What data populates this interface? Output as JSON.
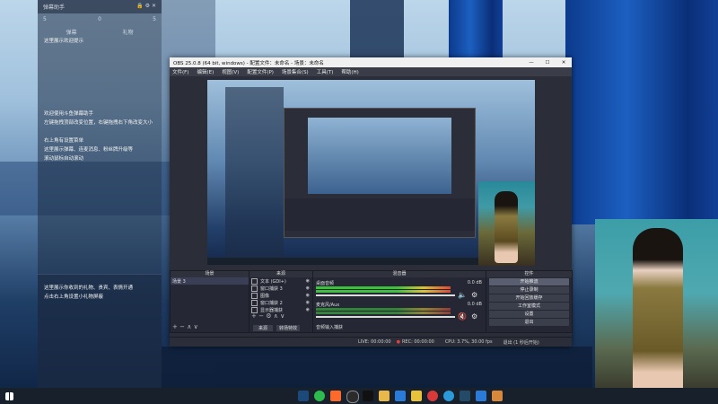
{
  "chat": {
    "header": "弹幕助手",
    "stats": [
      "5",
      "0",
      "5"
    ],
    "tabs": [
      "弹幕",
      "礼物"
    ],
    "messages": [
      "这里展示欢迎提示",
      "欢迎使用斗鱼弹幕助手",
      "左键拖拽顶部改变位置，右键拖拽右下角改变大小",
      "右上角有设置菜单",
      "这里展示弹幕、连麦消息、粉丝牌升级等",
      "滚动鼠标自动滚动"
    ],
    "gift_messages": [
      "这里展示你收到的礼物、贵宾、表情开通",
      "点击右上角设置小礼物屏蔽"
    ]
  },
  "obs": {
    "title": "OBS 25.0.8 (64 bit, windows) - 配置文件：未命名 - 场景：未命名",
    "window_controls": [
      "—",
      "☐",
      "✕"
    ],
    "menu": [
      "文件(F)",
      "编辑(E)",
      "视图(V)",
      "配置文件(P)",
      "场景集合(S)",
      "工具(T)",
      "帮助(H)"
    ],
    "docks": {
      "scenes": {
        "title": "场景",
        "items": [
          "场景 3"
        ]
      },
      "sources": {
        "title": "来源",
        "items": [
          "文本 (GDI+)",
          "窗口捕获 3",
          "图像",
          "窗口捕获 2",
          "显示器捕获"
        ]
      },
      "mixer": {
        "title": "混音器",
        "channels": [
          {
            "name": "桌面音频",
            "db": "0.0 dB"
          },
          {
            "name": "麦克风/Aux",
            "db": "0.0 dB"
          }
        ],
        "extra": "音频输入捕获"
      },
      "controls": {
        "title": "控件",
        "buttons": [
          "开始推流",
          "停止录制",
          "开始回放缓存",
          "工作室模式",
          "设置",
          "退出"
        ]
      }
    },
    "source_tabs": [
      "来源",
      "转场特效"
    ],
    "status": {
      "live": "LIVE: 00:00:00",
      "rec": "REC: 00:00:00",
      "cpu": "CPU: 3.7%, 30.00 fps",
      "scene_info": "退出 (1 秒后开始)"
    }
  },
  "taskbar": {
    "icons": [
      "windows-icon",
      "steam-icon",
      "wechat-icon",
      "douyu-icon",
      "obs-icon",
      "tiktok-icon",
      "folder-icon",
      "photos-icon",
      "qq-music-icon",
      "netease-music-icon",
      "edge-icon",
      "steam2-icon",
      "store-icon",
      "app-icon"
    ]
  },
  "colors": {
    "obs_bg": "#2b2e38",
    "meter_green": "#3fbf3f",
    "meter_yellow": "#d8c23a",
    "meter_red": "#d84a3a",
    "accent_blue": "#1c5fc0"
  }
}
